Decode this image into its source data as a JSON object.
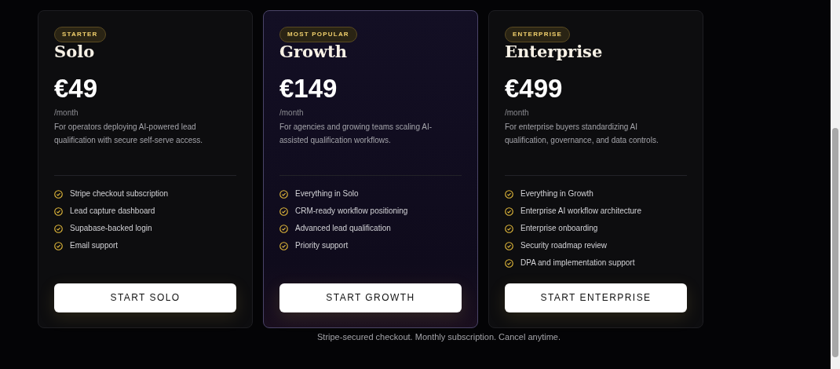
{
  "plans": [
    {
      "badge": "STARTER",
      "name": "Solo",
      "price": "€49",
      "period": "/month",
      "description": "For operators deploying AI-powered lead qualification with secure self-serve access.",
      "featured": false,
      "features": [
        "Stripe checkout subscription",
        "Lead capture dashboard",
        "Supabase-backed login",
        "Email support"
      ],
      "button": "START SOLO"
    },
    {
      "badge": "MOST POPULAR",
      "name": "Growth",
      "price": "€149",
      "period": "/month",
      "description": "For agencies and growing teams scaling AI-assisted qualification workflows.",
      "featured": true,
      "features": [
        "Everything in Solo",
        "CRM-ready workflow positioning",
        "Advanced lead qualification",
        "Priority support"
      ],
      "button": "START GROWTH"
    },
    {
      "badge": "ENTERPRISE",
      "name": "Enterprise",
      "price": "€499",
      "period": "/month",
      "description": "For enterprise buyers standardizing AI qualification, governance, and data controls.",
      "featured": false,
      "features": [
        "Everything in Growth",
        "Enterprise AI workflow architecture",
        "Enterprise onboarding",
        "Security roadmap review",
        "DPA and implementation support"
      ],
      "button": "START ENTERPRISE"
    }
  ],
  "note": "Stripe-secured checkout. Monthly subscription. Cancel anytime."
}
